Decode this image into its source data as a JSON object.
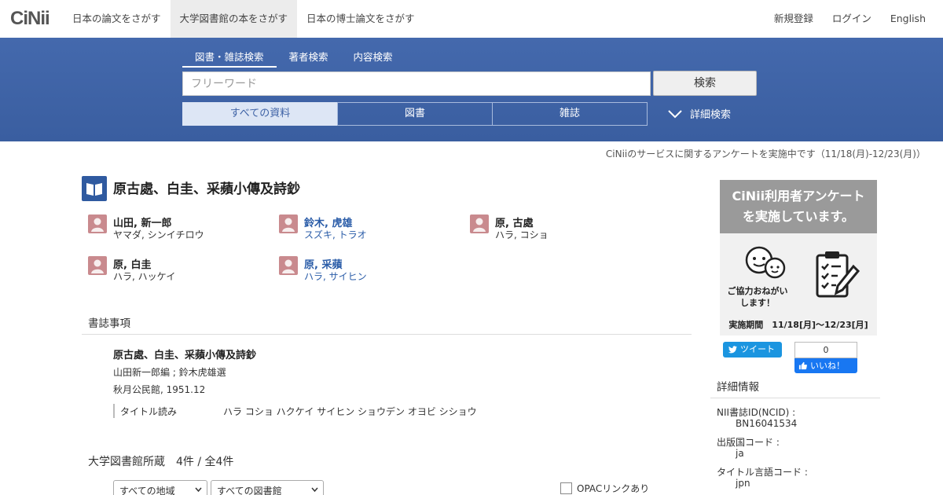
{
  "header": {
    "logo": "CiNii",
    "nav": [
      {
        "label": "日本の論文をさがす",
        "active": false
      },
      {
        "label": "大学図書館の本をさがす",
        "active": true
      },
      {
        "label": "日本の博士論文をさがす",
        "active": false
      }
    ],
    "links": [
      "新規登録",
      "ログイン",
      "English"
    ]
  },
  "search": {
    "tabs": [
      "図書・雑誌検索",
      "著者検索",
      "内容検索"
    ],
    "placeholder": "フリーワード",
    "value": "",
    "button": "検索",
    "types": [
      "すべての資料",
      "図書",
      "雑誌"
    ],
    "advanced": "詳細検索"
  },
  "notice": "CiNiiのサービスに関するアンケートを実施中です（11/18(月)-12/23(月)）",
  "record": {
    "title": "原古處、白圭、采蘋小傳及詩鈔",
    "authors": [
      {
        "name": "山田, 新一郎",
        "kana": "ヤマダ, シンイチロウ",
        "link": false
      },
      {
        "name": "鈴木, 虎雄",
        "kana": "スズキ, トラオ",
        "link": true
      },
      {
        "name": "原, 古處",
        "kana": "ハラ, コショ",
        "link": false
      },
      {
        "name": "原, 白圭",
        "kana": "ハラ, ハッケイ",
        "link": false
      },
      {
        "name": "原, 采蘋",
        "kana": "ハラ, サイヒン",
        "link": true
      }
    ],
    "bib_heading": "書誌事項",
    "bib_title": "原古處、白圭、采蘋小傳及詩鈔",
    "responsibility": "山田新一郎編 ; 鈴木虎雄選",
    "publication": "秋月公民館, 1951.12",
    "reading_label": "タイトル読み",
    "reading_value": "ハラ コショ ハクケイ サイヒン ショウデン オヨビ シショウ",
    "holdings": "大学図書館所蔵　4件 / 全4件",
    "region_select": "すべての地域",
    "library_select": "すべての図書館",
    "opac_label": "OPACリンクあり"
  },
  "sidebar": {
    "banner_title_1": "CiNii利用者アンケート",
    "banner_title_2": "を実施しています。",
    "banner_caption_1": "ご協力おねがい",
    "banner_caption_2": "します！",
    "banner_period": "実施期間　11/18[月]〜12/23[月]",
    "tweet": "ツイート",
    "fb_count": "0",
    "fb_like": "いいね！",
    "detail_heading": "詳細情報",
    "details": [
      {
        "key": "NII書誌ID(NCID) :",
        "value": "BN16041534"
      },
      {
        "key": "出版国コード :",
        "value": "ja"
      },
      {
        "key": "タイトル言語コード :",
        "value": "jpn"
      }
    ]
  },
  "colors": {
    "band": "#3f63a6",
    "link": "#2a5ca8",
    "avatar": "#c98a8e"
  }
}
